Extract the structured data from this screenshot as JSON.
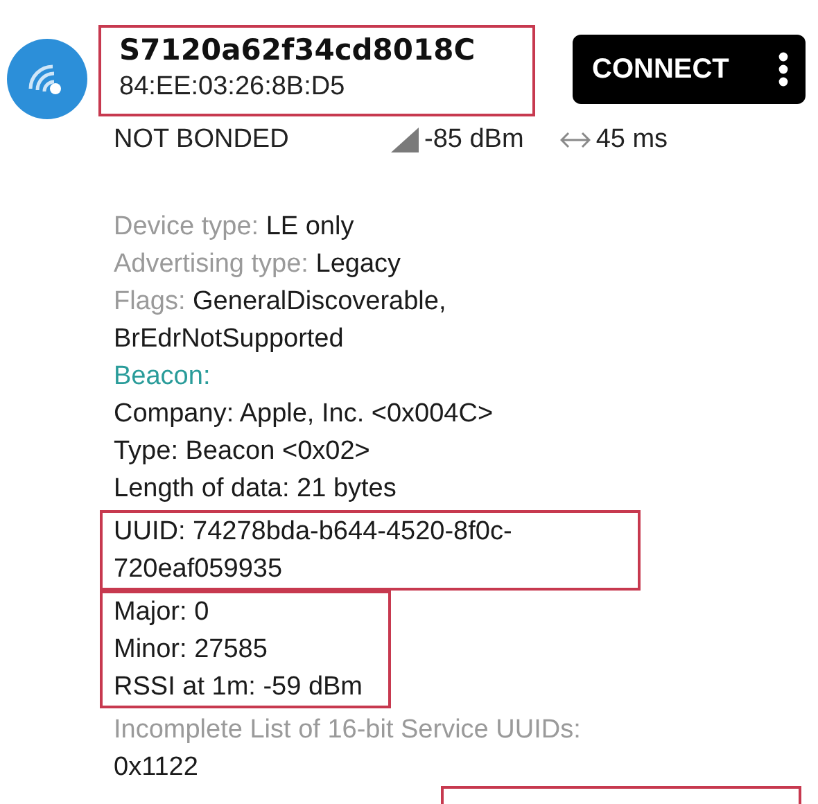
{
  "device": {
    "name": "S7120a62f34cd8018C",
    "address": "84:EE:03:26:8B:D5",
    "highlighted": true,
    "bond_state": "NOT BONDED",
    "rssi": "-85 dBm",
    "interval": "45 ms",
    "connect_label": "CONNECT"
  },
  "details": [
    {
      "highlighted": false,
      "lines": [
        {
          "kind": "field",
          "label": "Device type:",
          "value": "LE only"
        },
        {
          "kind": "field",
          "label": "Advertising type:",
          "value": "Legacy"
        },
        {
          "kind": "field",
          "label": "Flags:",
          "value": "GeneralDiscoverable, BrEdrNotSupported"
        },
        {
          "kind": "heading",
          "value": "Beacon:"
        },
        {
          "kind": "plain",
          "value": "Company: Apple, Inc. <0x004C>"
        },
        {
          "kind": "plain",
          "value": "Type: Beacon <0x02>"
        },
        {
          "kind": "plain",
          "value": "Length of data: 21 bytes"
        }
      ]
    },
    {
      "highlighted": true,
      "lines": [
        {
          "kind": "plain",
          "value": "UUID: 74278bda-b644-4520-8f0c-720eaf059935"
        }
      ]
    },
    {
      "highlighted": true,
      "lines": [
        {
          "kind": "plain",
          "value": "Major: 0"
        },
        {
          "kind": "plain",
          "value": "Minor: 27585"
        },
        {
          "kind": "plain",
          "value": "RSSI at 1m: -59 dBm"
        }
      ]
    },
    {
      "highlighted": false,
      "lines": [
        {
          "kind": "stacked",
          "label": "Incomplete List of 16-bit Service UUIDs:",
          "value": "0x1122"
        }
      ]
    }
  ],
  "trailing_highlight": true
}
